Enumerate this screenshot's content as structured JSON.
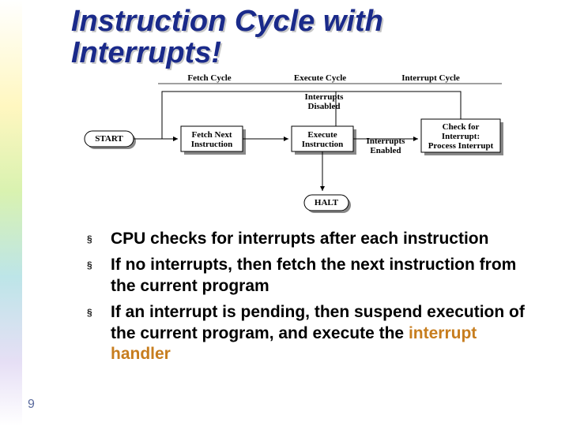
{
  "slide": {
    "title_line1": "Instruction Cycle with",
    "title_line2": "Interrupts!",
    "page_number": "9"
  },
  "diagram": {
    "headers": {
      "fetch": "Fetch Cycle",
      "execute": "Execute Cycle",
      "interrupt": "Interrupt Cycle"
    },
    "labels": {
      "interrupts_disabled_l1": "Interrupts",
      "interrupts_disabled_l2": "Disabled",
      "interrupts_enabled_l1": "Interrupts",
      "interrupts_enabled_l2": "Enabled"
    },
    "boxes": {
      "start": "START",
      "fetch_l1": "Fetch Next",
      "fetch_l2": "Instruction",
      "execute_l1": "Execute",
      "execute_l2": "Instruction",
      "check_l1": "Check for",
      "check_l2": "Interrupt:",
      "check_l3": "Process Interrupt",
      "halt": "HALT"
    }
  },
  "bullets": {
    "mark": "§",
    "items": [
      {
        "plain": "CPU checks for interrupts after each instruction"
      },
      {
        "plain": "If no interrupts, then fetch the next instruction from the current program"
      },
      {
        "pre": "If an interrupt is pending, then suspend execution of the current program, and execute the ",
        "hl1": "interrupt",
        "mid": " ",
        "hl2": "handler"
      }
    ]
  }
}
